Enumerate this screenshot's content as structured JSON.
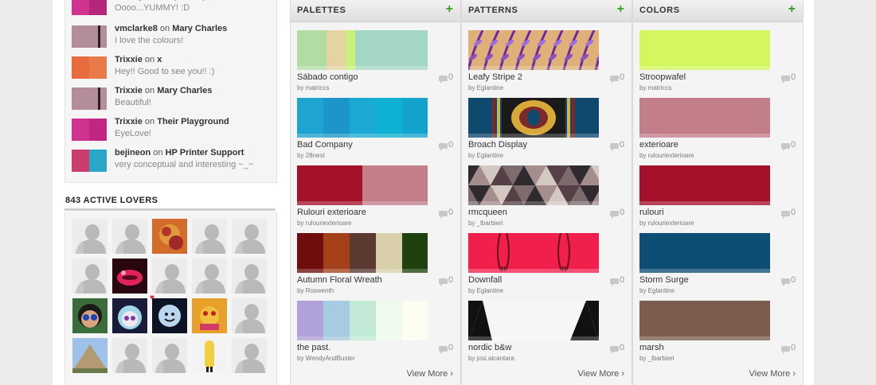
{
  "comments": [
    {
      "user": "SuezQ",
      "on": "on",
      "target": "daisy dandy",
      "text": "Oooo...YUMMY! :D",
      "colors": [
        "#d0338f",
        "#b5257a"
      ]
    },
    {
      "user": "vmclarke8",
      "on": "on",
      "target": "Mary Charles",
      "text": "I love the colours!",
      "colors": [
        "#b38e98",
        "#b38e98",
        "#2b1d1d",
        "#b38e98"
      ]
    },
    {
      "user": "Trixxie",
      "on": "on",
      "target": "x",
      "text": "Hey!! Good to see you!! :)",
      "colors": [
        "#e96b3d",
        "#e97a4a"
      ]
    },
    {
      "user": "Trixxie",
      "on": "on",
      "target": "Mary Charles",
      "text": "Beautiful!",
      "colors": [
        "#b38e98",
        "#b38e98",
        "#2b1d1d",
        "#b38e98"
      ]
    },
    {
      "user": "Trixxie",
      "on": "on",
      "target": "Their Playground",
      "text": "EyeLove!",
      "colors": [
        "#d0338f",
        "#c22683"
      ]
    },
    {
      "user": "bejineon",
      "on": "on",
      "target": "HP Printer Support",
      "text": "very conceptual and interesting ~_~",
      "colors": [
        "#cc3d6f",
        "#2aa6c8"
      ]
    }
  ],
  "lovers": {
    "title": "843 ACTIVE LOVERS",
    "avatars": [
      "default",
      "default",
      "photo-flower",
      "default",
      "default",
      "default",
      "photo-lips",
      "default",
      "default",
      "default",
      "photo-face-blue",
      "photo-anime",
      "photo-moon",
      "photo-toy",
      "default",
      "photo-pyramid",
      "default",
      "default",
      "photo-yellow-figure",
      "default"
    ]
  },
  "columns": [
    {
      "title": "PALETTES",
      "add": "+",
      "view_more": "View More ›",
      "items": [
        {
          "name": "Sábado contigo",
          "by": "by matriccs",
          "count": "0",
          "swatch": [
            "#b3dca4",
            "#e5d4a2",
            "#c8f07a",
            "#a4d6c6"
          ],
          "widths": [
            37,
            24,
            12,
            91
          ]
        },
        {
          "name": "Bad Company",
          "by": "by 28next",
          "count": "0",
          "swatch": [
            "#1ea4d0",
            "#1c95c8",
            "#1aa9d3",
            "#0fb1d2",
            "#14a3cc"
          ],
          "widths": [
            33,
            33,
            33,
            33,
            32
          ]
        },
        {
          "name": "Rulouri exterioare",
          "by": "by rulouriexterioare",
          "count": "0",
          "swatch": [
            "#a5102a",
            "#c27e89"
          ],
          "widths": [
            82,
            82
          ]
        },
        {
          "name": "Autumn Floral Wreath",
          "by": "by Roswenth",
          "count": "0",
          "swatch": [
            "#6e0d0e",
            "#a4411a",
            "#5a3a31",
            "#d9cfaa",
            "#20410d"
          ],
          "widths": [
            33,
            33,
            33,
            33,
            32
          ]
        },
        {
          "name": "the past.",
          "by": "by WendyAndBuster",
          "count": "0",
          "swatch": [
            "#b0a1d8",
            "#a7cbdf",
            "#c2ead7",
            "#eefbec",
            "#fcfdf0"
          ],
          "widths": [
            33,
            33,
            33,
            33,
            32
          ]
        }
      ]
    },
    {
      "title": "PATTERNS",
      "add": "+",
      "view_more": "View More ›",
      "items": [
        {
          "name": "Leafy Stripe 2",
          "by": "by Eglantine",
          "count": "0",
          "pattern": "leafy"
        },
        {
          "name": "Broach Display",
          "by": "by Eglantine",
          "count": "0",
          "pattern": "broach"
        },
        {
          "name": "rmcqueen",
          "by": "by _lbarbieri",
          "count": "0",
          "pattern": "triangles"
        },
        {
          "name": "Downfall",
          "by": "by Eglantine",
          "count": "0",
          "pattern": "downfall"
        },
        {
          "name": "nordic b&w",
          "by": "by josi.alcantara",
          "count": "0",
          "pattern": "nordic"
        }
      ]
    },
    {
      "title": "COLORS",
      "add": "+",
      "view_more": "View More ›",
      "items": [
        {
          "name": "Stroopwafel",
          "by": "by matriccs",
          "count": "0",
          "color": "#d4f75e"
        },
        {
          "name": "exterioare",
          "by": "by rulouriexterioare",
          "count": "0",
          "color": "#c27e89"
        },
        {
          "name": "rulouri",
          "by": "by rulouriexterioare",
          "count": "0",
          "color": "#a5102a"
        },
        {
          "name": "Storm Surge",
          "by": "by Eglantine",
          "count": "0",
          "color": "#0d4f74"
        },
        {
          "name": "marsh",
          "by": "by _lbarbieri",
          "count": "0",
          "color": "#7d5e4e"
        }
      ]
    }
  ]
}
